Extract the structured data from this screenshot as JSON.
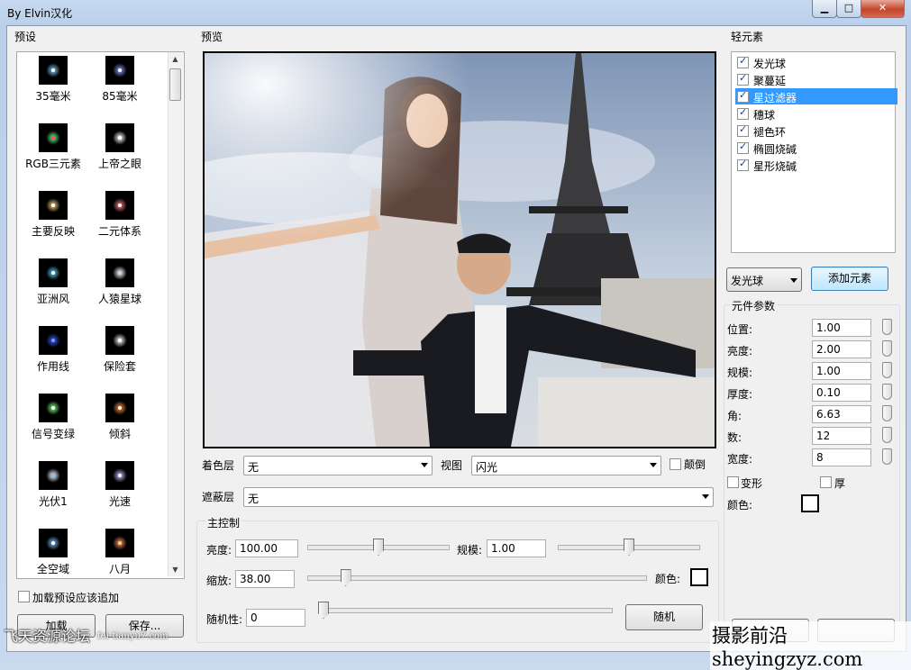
{
  "window": {
    "title": "By Elvin汉化",
    "minimize_glyph": "▁",
    "maximize_glyph": "□",
    "close_glyph": "✕"
  },
  "presets": {
    "heading": "预设",
    "items": [
      {
        "label": "35毫米"
      },
      {
        "label": "85毫米"
      },
      {
        "label": "RGB三元素"
      },
      {
        "label": "上帝之眼"
      },
      {
        "label": "主要反映"
      },
      {
        "label": "二元体系"
      },
      {
        "label": "亚洲风"
      },
      {
        "label": "人猿星球"
      },
      {
        "label": "作用线"
      },
      {
        "label": "保险套"
      },
      {
        "label": "信号变绿"
      },
      {
        "label": "倾斜"
      },
      {
        "label": "光伏1"
      },
      {
        "label": "光速"
      },
      {
        "label": "全空域"
      },
      {
        "label": "八月"
      }
    ],
    "append_checkbox_label": "加载预设应该追加",
    "load_button": "加载",
    "save_button": "保存..."
  },
  "preview": {
    "heading": "预览",
    "color_layer_label": "着色层",
    "color_layer_value": "无",
    "view_label": "视图",
    "view_value": "闪光",
    "invert_label": "颠倒",
    "mask_layer_label": "遮蔽层",
    "mask_layer_value": "无"
  },
  "main_control": {
    "heading": "主控制",
    "brightness_label": "亮度:",
    "brightness_value": "100.00",
    "scale_label": "规模:",
    "scale_value": "1.00",
    "zoom_label": "缩放:",
    "zoom_value": "38.00",
    "color_label": "颜色:",
    "random_label": "随机性:",
    "random_value": "0",
    "random_button": "随机",
    "brightness_level": 0.5,
    "scale_level": 0.5,
    "zoom_level": 0.1,
    "random_level": 0.0
  },
  "elements": {
    "heading": "轻元素",
    "items": [
      {
        "label": "发光球",
        "checked": true,
        "selected": false
      },
      {
        "label": "聚蔓延",
        "checked": true,
        "selected": false
      },
      {
        "label": "星过滤器",
        "checked": true,
        "selected": true
      },
      {
        "label": "穗球",
        "checked": true,
        "selected": false
      },
      {
        "label": "褪色环",
        "checked": true,
        "selected": false
      },
      {
        "label": "椭圆烧碱",
        "checked": true,
        "selected": false
      },
      {
        "label": "星形烧碱",
        "checked": true,
        "selected": false
      }
    ],
    "type_value": "发光球",
    "add_button": "添加元素"
  },
  "element_params": {
    "heading": "元件参数",
    "rows": [
      {
        "label": "位置:",
        "value": "1.00"
      },
      {
        "label": "亮度:",
        "value": "2.00"
      },
      {
        "label": "规模:",
        "value": "1.00"
      },
      {
        "label": "厚度:",
        "value": "0.10"
      },
      {
        "label": "角:",
        "value": "6.63"
      },
      {
        "label": "数:",
        "value": "12"
      },
      {
        "label": "宽度:",
        "value": "8"
      }
    ],
    "deform_label": "变形",
    "thick_label": "厚",
    "color_label": "颜色:"
  },
  "watermarks": {
    "left": "飞天资源论坛",
    "left_url": "fei-tianyu7.com",
    "right": "摄影前沿sheyingzyz.com"
  }
}
